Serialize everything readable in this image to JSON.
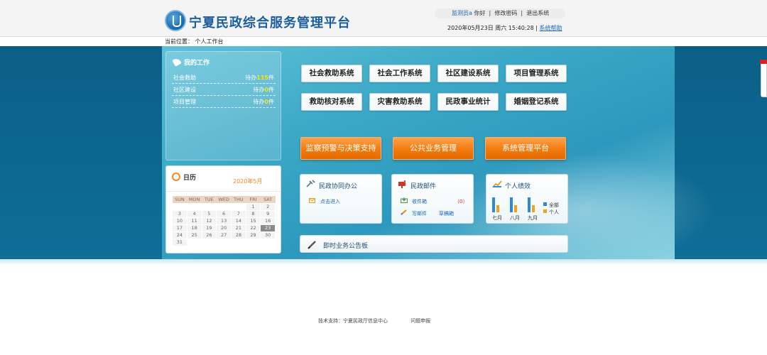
{
  "header": {
    "logo_text": "宁夏民政综合服务管理平台",
    "greeting_user": "监测员a",
    "greeting": "你好",
    "change_password": "修改密码",
    "logout": "退出系统",
    "datetime": "2020年05月23日 周六 15:40:28",
    "help": "系统帮助",
    "location": "当前位置： 个人工作台"
  },
  "mywork": {
    "title": "我的工作",
    "items": [
      {
        "name": "社会救助",
        "prefix": "待办",
        "count": "115",
        "suffix": "件"
      },
      {
        "name": "社区建设",
        "prefix": "待办",
        "count": "0",
        "suffix": "件"
      },
      {
        "name": "项目管理",
        "prefix": "待办",
        "count": "0",
        "suffix": "件"
      }
    ]
  },
  "calendar": {
    "title": "日历",
    "month": "2020年5月",
    "weekdays": [
      "SUN",
      "MON",
      "TUE",
      "WED",
      "THU",
      "FRI",
      "SAT"
    ],
    "weeks": [
      [
        "",
        "",
        "",
        "",
        "",
        "1",
        "2"
      ],
      [
        "3",
        "4",
        "5",
        "6",
        "7",
        "8",
        "9"
      ],
      [
        "10",
        "11",
        "12",
        "13",
        "14",
        "15",
        "16"
      ],
      [
        "17",
        "18",
        "19",
        "20",
        "21",
        "22",
        "23"
      ],
      [
        "24",
        "25",
        "26",
        "27",
        "28",
        "29",
        "30"
      ],
      [
        "31",
        "",
        "",
        "",
        "",
        "",
        ""
      ]
    ],
    "today": "23"
  },
  "systems": [
    "社会救助系统",
    "社会工作系统",
    "社区建设系统",
    "项目管理系统",
    "救助核对系统",
    "灾害救助系统",
    "民政事业统计",
    "婚姻登记系统"
  ],
  "platforms": [
    "监察预警与决策支持",
    "公共业务管理",
    "系统管理平台"
  ],
  "cards": {
    "office": {
      "title": "民政协同办公",
      "link": "点击进入"
    },
    "mail": {
      "title": "民政邮件",
      "inbox": "收件箱",
      "inbox_count": "（0）",
      "compose": "写邮件",
      "drafts": "草稿箱"
    },
    "performance": {
      "title": "个人绩效",
      "months": [
        "七月",
        "八月",
        "九月"
      ],
      "legend_all": "全部",
      "legend_personal": "个人"
    }
  },
  "notice": "即时业务公告板",
  "footer": {
    "support": "技术支持：宁夏民政厅信息中心",
    "feedback": "问题申报"
  }
}
